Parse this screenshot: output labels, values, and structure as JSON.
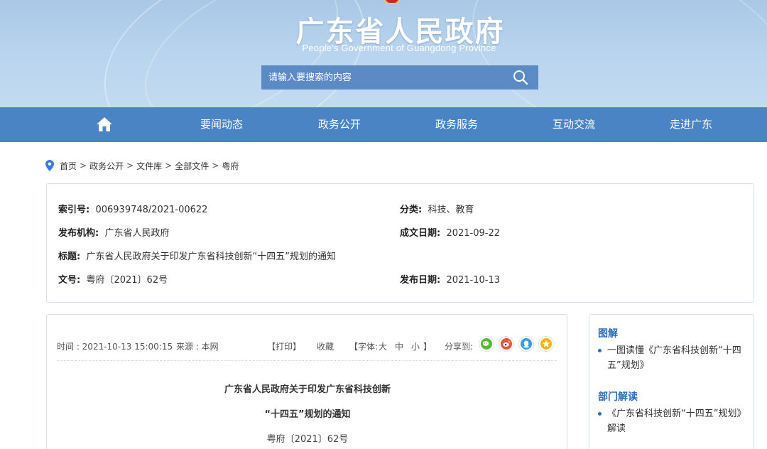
{
  "header": {
    "title": "广东省人民政府",
    "subtitle": "People's Government of Guangdong Province",
    "search_placeholder": "请输入要搜索的内容"
  },
  "nav": {
    "home_icon": "home-icon",
    "items": [
      "要闻动态",
      "政务公开",
      "政务服务",
      "互动交流",
      "走进广东"
    ]
  },
  "breadcrumb": [
    "首页",
    "政务公开",
    "文件库",
    "全部文件",
    "粤府"
  ],
  "info": {
    "index_label": "索引号:",
    "index_value": "006939748/2021-00622",
    "category_label": "分类:",
    "category_value": "科技、教育",
    "issuer_label": "发布机构:",
    "issuer_value": "广东省人民政府",
    "created_label": "成文日期:",
    "created_value": "2021-09-22",
    "title_label": "标题:",
    "title_value": "广东省人民政府关于印发广东省科技创新“十四五”规划的通知",
    "docno_label": "文号:",
    "docno_value": "粤府〔2021〕62号",
    "published_label": "发布日期:",
    "published_value": "2021-10-13"
  },
  "article": {
    "time": "时间 : 2021-10-13 15:00:15",
    "source": "来源 : 本网",
    "print": "【打印】",
    "favorite": "收藏",
    "font_open": "【字体:",
    "font_large": "大",
    "font_medium": "中",
    "font_small": "小",
    "font_close": "】",
    "share_label": "分享到:",
    "share_icons": [
      "wechat-icon",
      "weibo-icon",
      "qq-icon",
      "qzone-icon"
    ],
    "title_line1": "广东省人民政府关于印发广东省科技创新",
    "title_line2": "“十四五”规划的通知",
    "doc_number": "粤府〔2021〕62号"
  },
  "side": {
    "sections": [
      {
        "heading": "图解",
        "items": [
          "一图读懂《广东省科技创新“十四五”规划》"
        ]
      },
      {
        "heading": "部门解读",
        "items": [
          "《广东省科技创新“十四五”规划》解读"
        ]
      }
    ]
  },
  "colors": {
    "nav_bg": "#4a84c5",
    "search_bg": "#5b8ac4",
    "accent": "#2c6db5",
    "border": "#cfe0f1"
  }
}
